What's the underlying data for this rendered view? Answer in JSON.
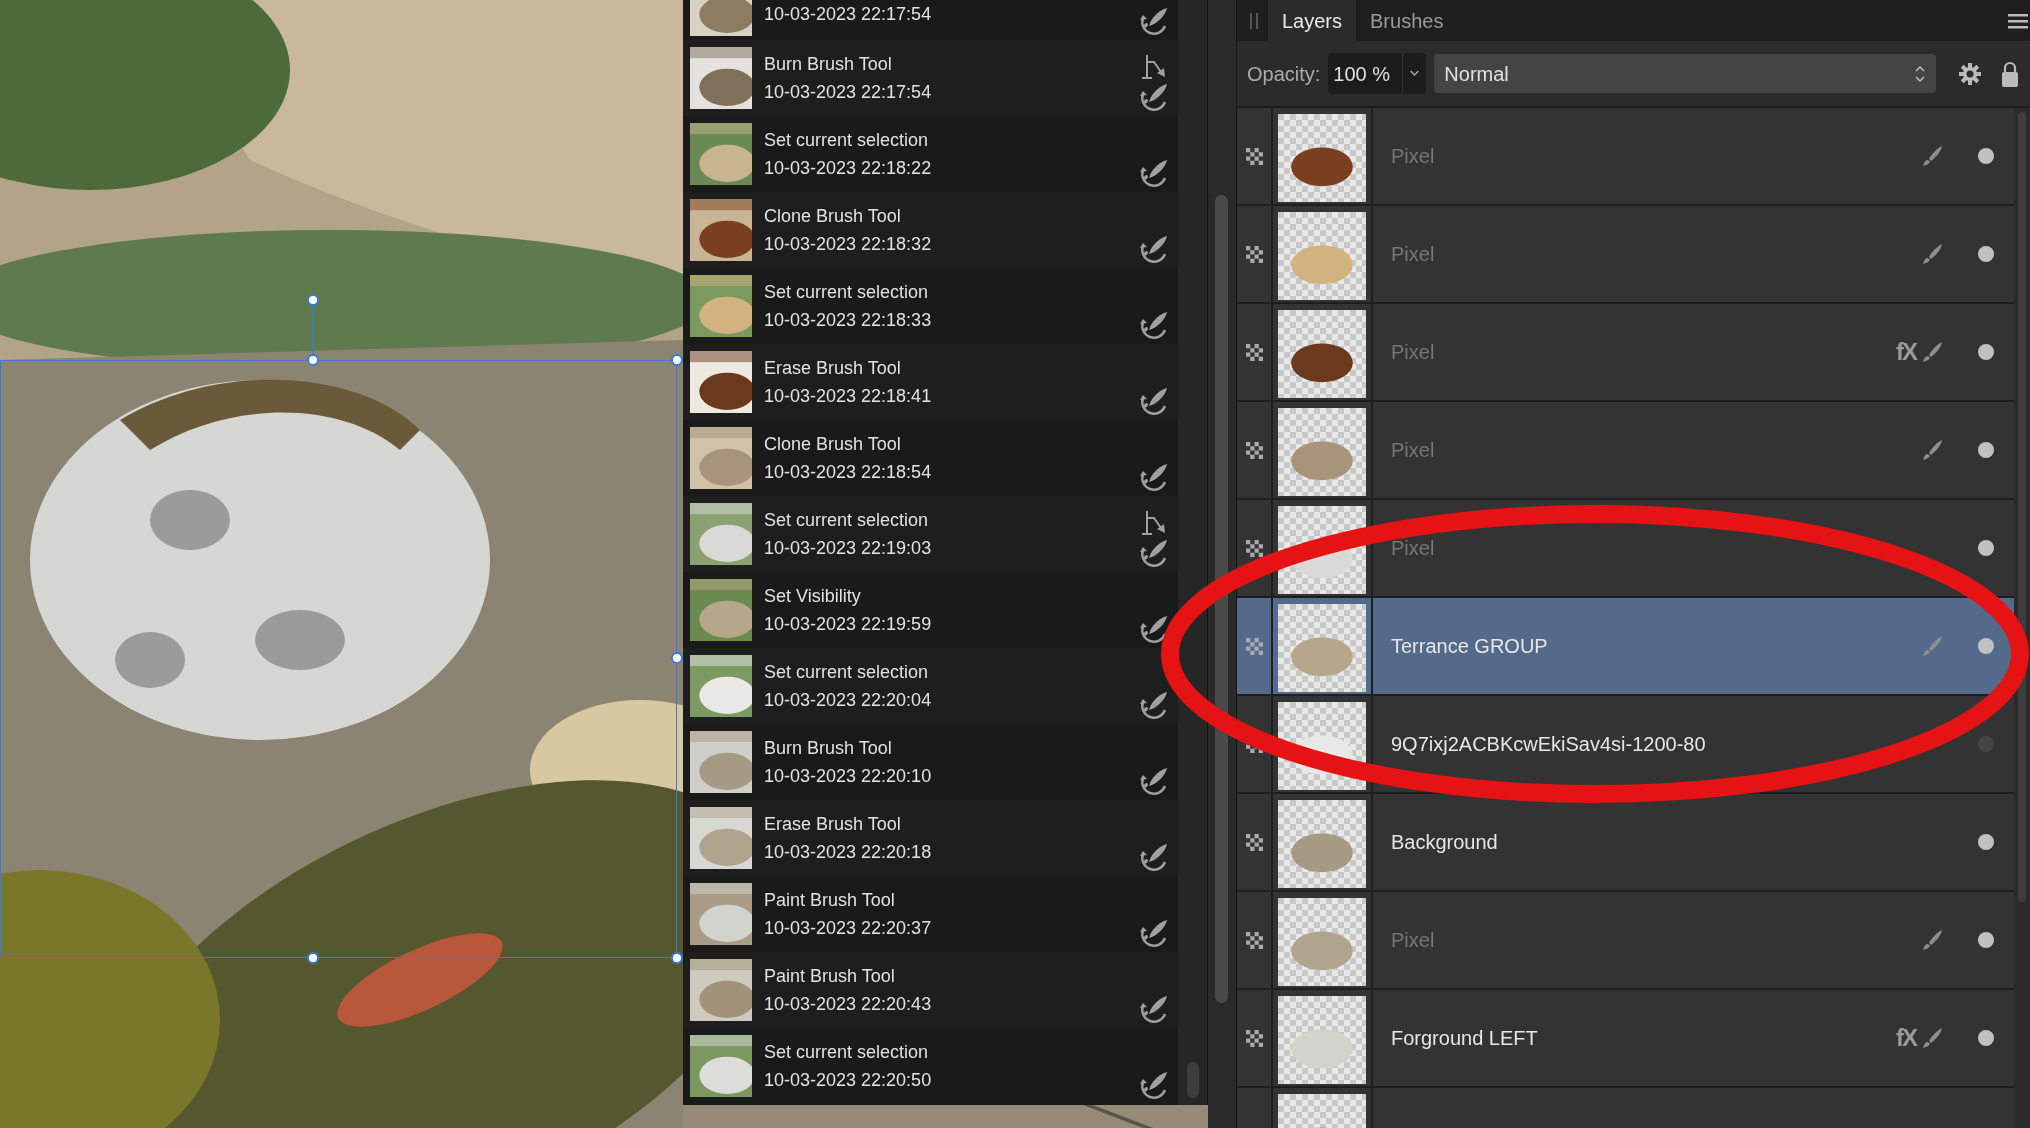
{
  "history": {
    "items": [
      {
        "time": "10-03-2023 22:17:54",
        "branch": false,
        "selected": false
      },
      {
        "label": "Burn Brush Tool",
        "time": "10-03-2023 22:17:54",
        "branch": true,
        "selected": false
      },
      {
        "label": "Set current selection",
        "time": "10-03-2023 22:18:22",
        "branch": false,
        "selected": false
      },
      {
        "label": "Clone Brush Tool",
        "time": "10-03-2023 22:18:32",
        "branch": false,
        "selected": false
      },
      {
        "label": "Set current selection",
        "time": "10-03-2023 22:18:33",
        "branch": false,
        "selected": false
      },
      {
        "label": "Erase Brush Tool",
        "time": "10-03-2023 22:18:41",
        "branch": false,
        "selected": false
      },
      {
        "label": "Clone Brush Tool",
        "time": "10-03-2023 22:18:54",
        "branch": false,
        "selected": false
      },
      {
        "label": "Set current selection",
        "time": "10-03-2023 22:19:03",
        "branch": true,
        "selected": false
      },
      {
        "label": "Set Visibility",
        "time": "10-03-2023 22:19:59",
        "branch": false,
        "selected": false
      },
      {
        "label": "Set current selection",
        "time": "10-03-2023 22:20:04",
        "branch": false,
        "selected": false
      },
      {
        "label": "Burn Brush Tool",
        "time": "10-03-2023 22:20:10",
        "branch": false,
        "selected": false
      },
      {
        "label": "Erase Brush Tool",
        "time": "10-03-2023 22:20:18",
        "branch": false,
        "selected": false
      },
      {
        "label": "Paint Brush Tool",
        "time": "10-03-2023 22:20:37",
        "branch": false,
        "selected": false
      },
      {
        "label": "Paint Brush Tool",
        "time": "10-03-2023 22:20:43",
        "branch": false,
        "selected": false
      },
      {
        "label": "Set current selection",
        "time": "10-03-2023 22:20:50",
        "branch": false,
        "selected": false
      }
    ]
  },
  "layers_panel": {
    "tabs": [
      {
        "label": "Layers",
        "selected": true
      },
      {
        "label": "Brushes",
        "selected": false
      }
    ],
    "opacity_label": "Opacity:",
    "opacity": "100 %",
    "blend_mode": "Normal",
    "layers": [
      {
        "name": "Pixel",
        "dimmed": true,
        "selected": false,
        "brush": true,
        "visible": true
      },
      {
        "name": "Pixel",
        "dimmed": true,
        "selected": false,
        "brush": true,
        "visible": true
      },
      {
        "name": "Pixel",
        "dimmed": true,
        "selected": false,
        "fx": "fX",
        "brush": true,
        "visible": true
      },
      {
        "name": "Pixel",
        "dimmed": true,
        "selected": false,
        "brush": true,
        "visible": true
      },
      {
        "name": "Pixel",
        "dimmed": true,
        "selected": false,
        "brush": false,
        "visible": true
      },
      {
        "name": "Terrance GROUP",
        "dimmed": false,
        "selected": true,
        "brush": true,
        "visible": true
      },
      {
        "name": "9Q7ixj2ACBKcwEkiSav4si-1200-80",
        "dimmed": false,
        "selected": false,
        "brush": false,
        "visible": false
      },
      {
        "name": "Background",
        "dimmed": false,
        "selected": false,
        "brush": false,
        "visible": true
      },
      {
        "name": "Pixel",
        "dimmed": true,
        "selected": false,
        "brush": true,
        "visible": true
      },
      {
        "name": "Forground LEFT",
        "dimmed": false,
        "selected": false,
        "fx": "fX",
        "brush": true,
        "visible": true
      },
      {
        "selected": false,
        "brush": false
      }
    ]
  }
}
